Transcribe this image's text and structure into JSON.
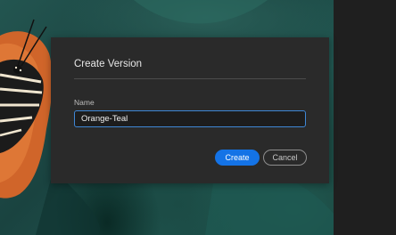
{
  "dialog": {
    "title": "Create Version",
    "name_label": "Name",
    "name_value": "Orange-Teal",
    "create_label": "Create",
    "cancel_label": "Cancel"
  },
  "colors": {
    "accent": "#1473e6",
    "dialog_bg": "#2a2a2a",
    "focus_border": "#3f87d6"
  }
}
